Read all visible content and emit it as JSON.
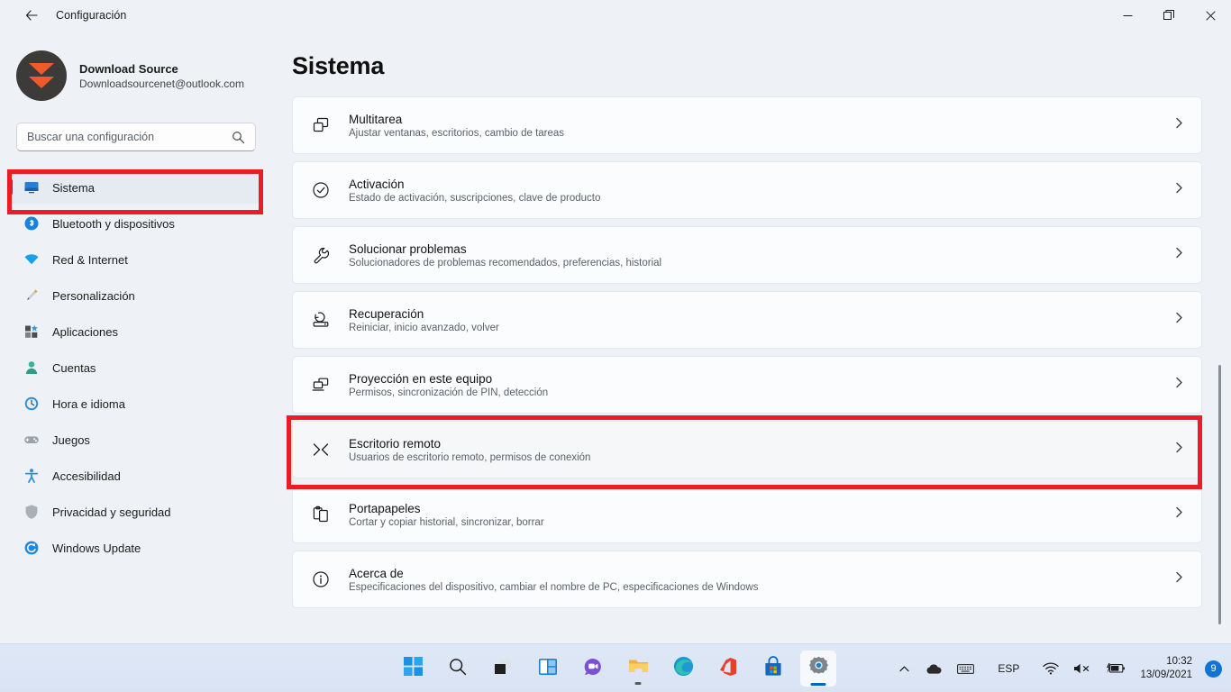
{
  "window": {
    "title": "Configuración",
    "back_icon": "back-arrow-icon",
    "minimize_label": "Minimizar",
    "restore_label": "Restaurar",
    "close_label": "Cerrar"
  },
  "account": {
    "name": "Download Source",
    "email": "Downloadsourcenet@outlook.com",
    "avatar_bg": "#3c3b39",
    "avatar_accent": "#f05a28"
  },
  "search": {
    "placeholder": "Buscar una configuración",
    "value": "",
    "icon": "search-icon"
  },
  "sidebar": {
    "items": [
      {
        "label": "Sistema",
        "icon": "display-icon",
        "active": true
      },
      {
        "label": "Bluetooth y dispositivos",
        "icon": "bluetooth-icon",
        "active": false
      },
      {
        "label": "Red & Internet",
        "icon": "wifi-icon",
        "active": false
      },
      {
        "label": "Personalización",
        "icon": "paintbrush-icon",
        "active": false
      },
      {
        "label": "Aplicaciones",
        "icon": "apps-icon",
        "active": false
      },
      {
        "label": "Cuentas",
        "icon": "person-icon",
        "active": false
      },
      {
        "label": "Hora e idioma",
        "icon": "clock-icon",
        "active": false
      },
      {
        "label": "Juegos",
        "icon": "gamepad-icon",
        "active": false
      },
      {
        "label": "Accesibilidad",
        "icon": "accessibility-icon",
        "active": false
      },
      {
        "label": "Privacidad y seguridad",
        "icon": "shield-icon",
        "active": false
      },
      {
        "label": "Windows Update",
        "icon": "update-icon",
        "active": false
      }
    ]
  },
  "main": {
    "title": "Sistema",
    "cards": [
      {
        "title": "Multitarea",
        "sub": "Ajustar ventanas, escritorios, cambio de tareas",
        "icon": "multitask-icon",
        "highlighted": false
      },
      {
        "title": "Activación",
        "sub": "Estado de activación, suscripciones, clave de producto",
        "icon": "check-circle-icon",
        "highlighted": false
      },
      {
        "title": "Solucionar problemas",
        "sub": "Solucionadores de problemas recomendados, preferencias, historial",
        "icon": "wrench-icon",
        "highlighted": false
      },
      {
        "title": "Recuperación",
        "sub": "Reiniciar, inicio avanzado, volver",
        "icon": "recovery-icon",
        "highlighted": false
      },
      {
        "title": "Proyección en este equipo",
        "sub": "Permisos, sincronización de PIN, detección",
        "icon": "projection-icon",
        "highlighted": false
      },
      {
        "title": "Escritorio remoto",
        "sub": "Usuarios de escritorio remoto, permisos de conexión",
        "icon": "remote-desktop-icon",
        "highlighted": true
      },
      {
        "title": "Portapapeles",
        "sub": "Cortar y copiar historial, sincronizar, borrar",
        "icon": "clipboard-icon",
        "highlighted": false
      },
      {
        "title": "Acerca de",
        "sub": "Especificaciones del dispositivo, cambiar el nombre de PC, especificaciones de Windows",
        "icon": "info-circle-icon",
        "highlighted": false
      }
    ],
    "chevron_icon": "chevron-right-icon"
  },
  "annotations": {
    "color": "#ec1c24",
    "regions": [
      {
        "name": "sidebar-sistema-highlight"
      },
      {
        "name": "escritorio-remoto-highlight"
      }
    ]
  },
  "taskbar": {
    "items": [
      {
        "name": "start",
        "label": "Inicio",
        "icon": "windows-logo-icon"
      },
      {
        "name": "search",
        "label": "Buscar",
        "icon": "search-icon"
      },
      {
        "name": "task-view",
        "label": "Vista de tareas",
        "icon": "task-view-icon"
      },
      {
        "name": "widgets",
        "label": "Widgets",
        "icon": "widgets-icon"
      },
      {
        "name": "chat",
        "label": "Chat",
        "icon": "chat-icon"
      },
      {
        "name": "file-explorer",
        "label": "Explorador de archivos",
        "icon": "folder-icon"
      },
      {
        "name": "edge",
        "label": "Microsoft Edge",
        "icon": "edge-icon"
      },
      {
        "name": "office",
        "label": "Office",
        "icon": "office-icon"
      },
      {
        "name": "store",
        "label": "Microsoft Store",
        "icon": "store-icon"
      },
      {
        "name": "settings",
        "label": "Configuración",
        "icon": "gear-icon"
      }
    ],
    "tray": {
      "overflow_icon": "chevron-up-icon",
      "onedrive_icon": "cloud-icon",
      "ime_icon": "keyboard-icon",
      "language": "ESP",
      "wifi_icon": "wifi-icon",
      "volume_icon": "speaker-muted-icon",
      "battery_icon": "battery-charging-icon",
      "time": "10:32",
      "date": "13/09/2021",
      "notification_count": "9"
    }
  }
}
